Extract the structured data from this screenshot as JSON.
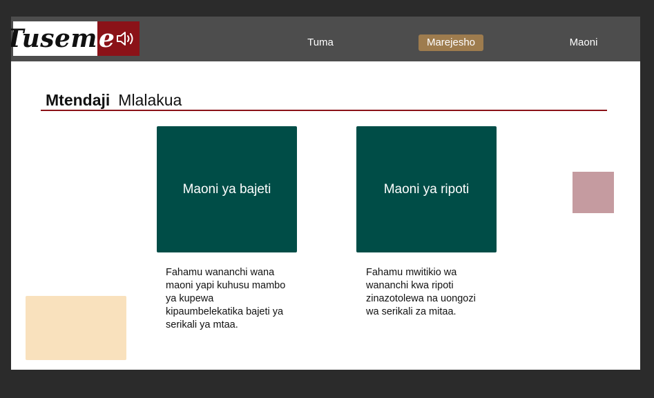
{
  "brand": {
    "logo_main": "Tusem",
    "logo_e": "e"
  },
  "nav": {
    "items": [
      {
        "label": "Tuma",
        "active": false
      },
      {
        "label": "Marejesho",
        "active": true
      },
      {
        "label": "Maoni",
        "active": false
      }
    ]
  },
  "page": {
    "heading_role": "Mtendaji",
    "heading_name": "Mlalakua"
  },
  "cards": [
    {
      "title": "Maoni ya bajeti",
      "description": "Fahamu wananchi wana maoni yapi kuhusu mambo ya kupewa kipaumbelekatika bajeti ya serikali ya mtaa."
    },
    {
      "title": "Maoni ya ripoti",
      "description": "Fahamu mwitikio wa wananchi kwa ripoti zinazotolewa na uongozi wa serikali za mitaa."
    }
  ],
  "colors": {
    "navbar": "#4d4d4d",
    "brand_red": "#8b1218",
    "active_tab": "#9e7c4e",
    "card": "#004d47",
    "pink_block": "#c59ba0",
    "peach_block": "#f9e1bd"
  },
  "icons": {
    "logo_icon": "speaker-icon"
  }
}
